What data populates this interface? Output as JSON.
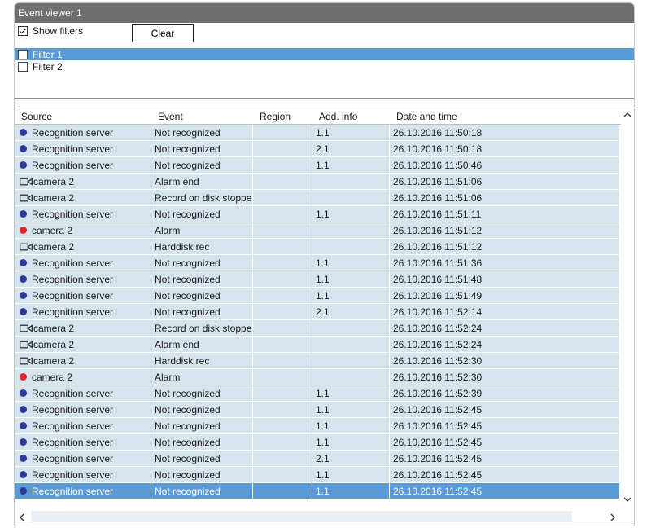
{
  "window": {
    "title": "Event viewer 1"
  },
  "toolbar": {
    "show_filters_label": "Show filters",
    "show_filters_checked": true,
    "clear_label": "Clear"
  },
  "filters": [
    {
      "label": "Filter 1",
      "checked": false,
      "selected": true
    },
    {
      "label": "Filter 2",
      "checked": false,
      "selected": false
    }
  ],
  "columns": [
    "Source",
    "Event",
    "Region",
    "Add. info",
    "Date and time"
  ],
  "rows": [
    {
      "icon": "server-dot-icon",
      "source": "Recognition server",
      "event": "Not recognized",
      "region": "",
      "info": "1.1",
      "datetime": "26.10.2016 11:50:18"
    },
    {
      "icon": "server-dot-icon",
      "source": "Recognition server",
      "event": "Not recognized",
      "region": "",
      "info": "2.1",
      "datetime": "26.10.2016 11:50:18"
    },
    {
      "icon": "server-dot-icon",
      "source": "Recognition server",
      "event": "Not recognized",
      "region": "",
      "info": "1.1",
      "datetime": "26.10.2016 11:50:46"
    },
    {
      "icon": "camera-icon",
      "source": "camera 2",
      "event": "Alarm end",
      "region": "",
      "info": "",
      "datetime": "26.10.2016 11:51:06"
    },
    {
      "icon": "camera-icon",
      "source": "camera 2",
      "event": "Record on disk stopped",
      "region": "",
      "info": "",
      "datetime": "26.10.2016 11:51:06"
    },
    {
      "icon": "server-dot-icon",
      "source": "Recognition server",
      "event": "Not recognized",
      "region": "",
      "info": "1.1",
      "datetime": "26.10.2016 11:51:11"
    },
    {
      "icon": "alarm-dot-icon",
      "source": "camera 2",
      "event": "Alarm",
      "region": "",
      "info": "",
      "datetime": "26.10.2016 11:51:12"
    },
    {
      "icon": "camera-icon",
      "source": "camera 2",
      "event": "Harddisk rec",
      "region": "",
      "info": "",
      "datetime": "26.10.2016 11:51:12"
    },
    {
      "icon": "server-dot-icon",
      "source": "Recognition server",
      "event": "Not recognized",
      "region": "",
      "info": "1.1",
      "datetime": "26.10.2016 11:51:36"
    },
    {
      "icon": "server-dot-icon",
      "source": "Recognition server",
      "event": "Not recognized",
      "region": "",
      "info": "1.1",
      "datetime": "26.10.2016 11:51:48"
    },
    {
      "icon": "server-dot-icon",
      "source": "Recognition server",
      "event": "Not recognized",
      "region": "",
      "info": "1.1",
      "datetime": "26.10.2016 11:51:49"
    },
    {
      "icon": "server-dot-icon",
      "source": "Recognition server",
      "event": "Not recognized",
      "region": "",
      "info": "2.1",
      "datetime": "26.10.2016 11:52:14"
    },
    {
      "icon": "camera-icon",
      "source": "camera 2",
      "event": "Record on disk stopped",
      "region": "",
      "info": "",
      "datetime": "26.10.2016 11:52:24"
    },
    {
      "icon": "camera-icon",
      "source": "camera 2",
      "event": "Alarm end",
      "region": "",
      "info": "",
      "datetime": "26.10.2016 11:52:24"
    },
    {
      "icon": "camera-icon",
      "source": "camera 2",
      "event": "Harddisk rec",
      "region": "",
      "info": "",
      "datetime": "26.10.2016 11:52:30"
    },
    {
      "icon": "alarm-dot-icon",
      "source": "camera 2",
      "event": "Alarm",
      "region": "",
      "info": "",
      "datetime": "26.10.2016 11:52:30"
    },
    {
      "icon": "server-dot-icon",
      "source": "Recognition server",
      "event": "Not recognized",
      "region": "",
      "info": "1.1",
      "datetime": "26.10.2016 11:52:39"
    },
    {
      "icon": "server-dot-icon",
      "source": "Recognition server",
      "event": "Not recognized",
      "region": "",
      "info": "1.1",
      "datetime": "26.10.2016 11:52:45"
    },
    {
      "icon": "server-dot-icon",
      "source": "Recognition server",
      "event": "Not recognized",
      "region": "",
      "info": "1.1",
      "datetime": "26.10.2016 11:52:45"
    },
    {
      "icon": "server-dot-icon",
      "source": "Recognition server",
      "event": "Not recognized",
      "region": "",
      "info": "1.1",
      "datetime": "26.10.2016 11:52:45"
    },
    {
      "icon": "server-dot-icon",
      "source": "Recognition server",
      "event": "Not recognized",
      "region": "",
      "info": "2.1",
      "datetime": "26.10.2016 11:52:45"
    },
    {
      "icon": "server-dot-icon",
      "source": "Recognition server",
      "event": "Not recognized",
      "region": "",
      "info": "1.1",
      "datetime": "26.10.2016 11:52:45"
    },
    {
      "icon": "server-dot-icon",
      "source": "Recognition server",
      "event": "Not recognized",
      "region": "",
      "info": "1.1",
      "datetime": "26.10.2016 11:52:45",
      "selected": true
    }
  ],
  "colors": {
    "server_dot": "#2e3a9b",
    "alarm_dot": "#e3262a",
    "row_bg": "#d6e4ee",
    "selection": "#5b9bd5",
    "titlebar": "#6f6f6f"
  }
}
